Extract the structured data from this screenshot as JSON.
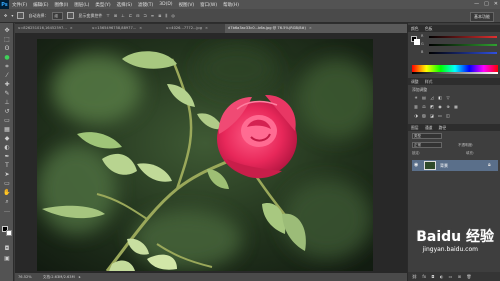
{
  "app": {
    "logo": "Ps"
  },
  "menu": [
    "文件(F)",
    "编辑(E)",
    "图像(I)",
    "图层(L)",
    "类型(Y)",
    "选择(S)",
    "滤镜(T)",
    "3D(D)",
    "视图(V)",
    "窗口(W)",
    "帮助(H)"
  ],
  "window_controls": [
    "—",
    "□",
    "✕"
  ],
  "options": {
    "auto_select_label": "自动选择：",
    "auto_select_value": "组",
    "show_transform_label": "显示变换控件",
    "workspace": "基本功能"
  },
  "tabs": [
    {
      "label": "u=826251016,16452597...",
      "active": false
    },
    {
      "label": "u=1565496758,88977...",
      "active": false
    },
    {
      "label": "u=4026...7772...jpg",
      "active": false
    },
    {
      "label": "d7b6a3ac33c0...b6a.jpg @ 76.5%(RGB/8#)",
      "active": true
    }
  ],
  "status": {
    "zoom": "76.52%",
    "doc": "文档:2.63M/2.63M"
  },
  "color_panel": {
    "tabs": [
      "颜色",
      "色板"
    ],
    "labels": [
      "R",
      "G",
      "B"
    ],
    "colors": {
      "r": "#e03030",
      "g": "#30a030",
      "b": "#3050e0"
    }
  },
  "adjust_panel": {
    "tabs": [
      "调整",
      "样式"
    ],
    "title": "添加调整"
  },
  "layers_panel": {
    "tabs": [
      "图层",
      "通道",
      "路径"
    ],
    "kind_label": "类型",
    "blend_mode": "正常",
    "opacity_label": "不透明度:",
    "lock_label": "锁定:",
    "fill_label": "填充:",
    "layers": [
      {
        "name": "背景",
        "selected": true
      }
    ]
  },
  "watermark": {
    "brand": "Baidu 经验",
    "url": "jingyan.baidu.com"
  }
}
